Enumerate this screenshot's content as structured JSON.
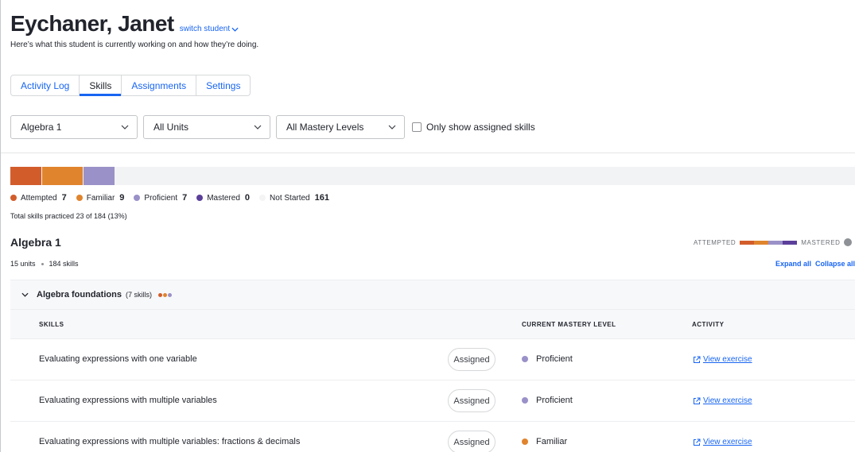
{
  "header": {
    "student_name": "Eychaner, Janet",
    "switch_label": "switch student",
    "subtitle": "Here’s what this student is currently working on and how they’re doing."
  },
  "tabs": [
    {
      "label": "Activity Log",
      "active": false
    },
    {
      "label": "Skills",
      "active": true
    },
    {
      "label": "Assignments",
      "active": false
    },
    {
      "label": "Settings",
      "active": false
    }
  ],
  "filters": {
    "course": "Algebra 1",
    "units": "All Units",
    "mastery_levels": "All Mastery Levels",
    "only_assigned_label": "Only show assigned skills",
    "only_assigned_checked": false
  },
  "progress": {
    "total_skills": 184,
    "segments": [
      {
        "name": "Attempted",
        "count": 7,
        "color": "#d25d2b"
      },
      {
        "name": "Familiar",
        "count": 9,
        "color": "#e0842e"
      },
      {
        "name": "Proficient",
        "count": 7,
        "color": "#9a91c8"
      },
      {
        "name": "Mastered",
        "count": 0,
        "color": "#5b3f9a"
      }
    ],
    "not_started": {
      "name": "Not Started",
      "count": 161,
      "color": "#eeeeee"
    },
    "total_practiced_text": "Total skills practiced 23 of 184 (13%)"
  },
  "course": {
    "title": "Algebra 1",
    "units": "15 units",
    "skills": "184 skills",
    "scale_start": "ATTEMPTED",
    "scale_end": "MASTERED",
    "scale_colors": [
      "#d25d2b",
      "#e0842e",
      "#9a91c8",
      "#5b3f9a"
    ],
    "expand_all": "Expand all",
    "collapse_all": "Collapse all"
  },
  "unit": {
    "name": "Algebra foundations",
    "count_label": "(7 skills)",
    "dot_colors": [
      "#d25d2b",
      "#e0842e",
      "#9a91c8"
    ]
  },
  "columns": {
    "skills": "SKILLS",
    "mastery": "CURRENT MASTERY LEVEL",
    "activity": "ACTIVITY"
  },
  "rows": [
    {
      "skill": "Evaluating expressions with one variable",
      "assigned": "Assigned",
      "mastery": "Proficient",
      "mastery_color": "#9a91c8",
      "activity": "View exercise"
    },
    {
      "skill": "Evaluating expressions with multiple variables",
      "assigned": "Assigned",
      "mastery": "Proficient",
      "mastery_color": "#9a91c8",
      "activity": "View exercise"
    },
    {
      "skill": "Evaluating expressions with multiple variables: fractions & decimals",
      "assigned": "Assigned",
      "mastery": "Familiar",
      "mastery_color": "#e0842e",
      "activity": "View exercise"
    }
  ]
}
